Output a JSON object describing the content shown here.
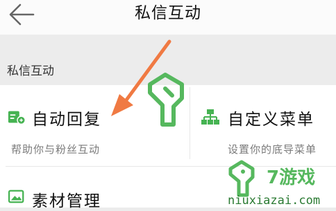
{
  "header": {
    "title": "私信互动",
    "back_icon": "arrow-left-icon"
  },
  "section": {
    "label": "私信互动"
  },
  "items": [
    {
      "title": "自动回复",
      "desc": "帮助你与粉丝互动",
      "icon": "auto-reply-icon"
    },
    {
      "title": "自定义菜单",
      "desc": "设置你的底导菜单",
      "icon": "custom-menu-icon"
    },
    {
      "title": "素材管理",
      "desc": "",
      "icon": "material-icon"
    }
  ],
  "watermark": {
    "brand": "7游戏",
    "url": "niuxiazai.com"
  },
  "colors": {
    "accent": "#46b352",
    "arrow": "#f07a43",
    "watermark": "#56b85e"
  }
}
